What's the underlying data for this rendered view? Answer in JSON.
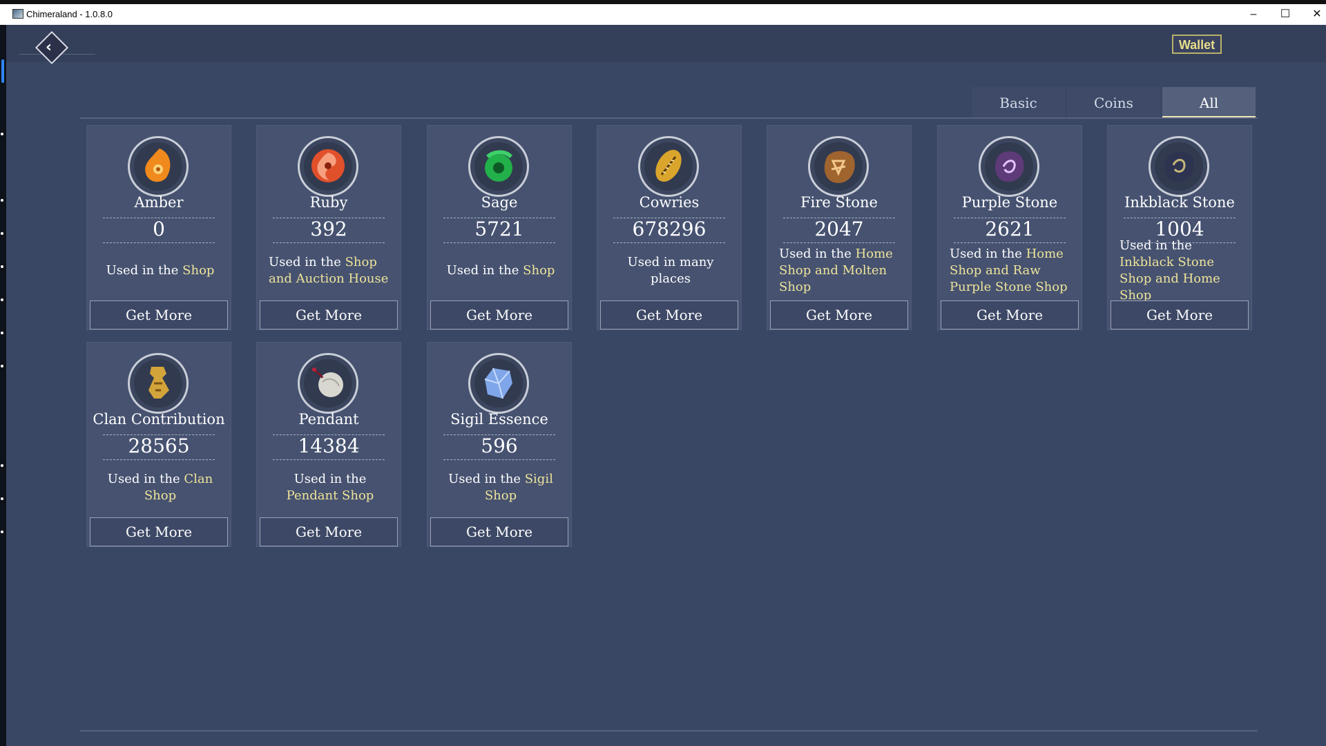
{
  "window": {
    "title": "Chimeraland - 1.0.8.0",
    "minimize": "–",
    "maximize": "☐",
    "close": "✕"
  },
  "header": {
    "back_icon": "chevron-left-icon",
    "back_glyph": "‹",
    "wallet_label": "Wallet"
  },
  "tabs": [
    {
      "label": "Basic",
      "selected": false
    },
    {
      "label": "Coins",
      "selected": false
    },
    {
      "label": "All",
      "selected": true
    }
  ],
  "cards": [
    {
      "name": "Amber",
      "count": "0",
      "desc_prefix": "Used in the ",
      "desc_hl": "Shop",
      "button": "Get More",
      "icon": "amber-icon",
      "color": "#f08a1c"
    },
    {
      "name": "Ruby",
      "count": "392",
      "desc_prefix": "Used in the ",
      "desc_hl": "Shop and Auction House",
      "button": "Get More",
      "icon": "ruby-icon",
      "color": "#e0502a"
    },
    {
      "name": "Sage",
      "count": "5721",
      "desc_prefix": "Used in the ",
      "desc_hl": "Shop",
      "button": "Get More",
      "icon": "sage-icon",
      "color": "#22b04a"
    },
    {
      "name": "Cowries",
      "count": "678296",
      "desc_prefix": "Used in many places",
      "desc_hl": "",
      "button": "Get More",
      "icon": "cowrie-shell-icon",
      "color": "#d9a52c"
    },
    {
      "name": "Fire Stone",
      "count": "2047",
      "desc_prefix": "Used in the ",
      "desc_hl": "Home Shop and Molten Shop",
      "button": "Get More",
      "icon": "fire-stone-icon",
      "color": "#a0642e"
    },
    {
      "name": "Purple Stone",
      "count": "2621",
      "desc_prefix": "Used in the ",
      "desc_hl": "Home Shop and Raw Purple Stone Shop",
      "button": "Get More",
      "icon": "purple-stone-icon",
      "color": "#5e3a78"
    },
    {
      "name": "Inkblack Stone",
      "count": "1004",
      "desc_prefix": "Used in the ",
      "desc_hl": "Inkblack Stone Shop and Home Shop",
      "button": "Get More",
      "icon": "inkblack-stone-icon",
      "color": "#2e3350"
    },
    {
      "name": "Clan Contribution",
      "count": "28565",
      "desc_prefix": "Used in the ",
      "desc_hl": "Clan Shop",
      "button": "Get More",
      "icon": "clan-token-icon",
      "color": "#d3a43a"
    },
    {
      "name": "Pendant",
      "count": "14384",
      "desc_prefix": "Used in the ",
      "desc_hl": "Pendant Shop",
      "button": "Get More",
      "icon": "pendant-icon",
      "color": "#d8d8d0"
    },
    {
      "name": "Sigil Essence",
      "count": "596",
      "desc_prefix": "Used in the ",
      "desc_hl": "Sigil Shop",
      "button": "Get More",
      "icon": "sigil-crystal-icon",
      "color": "#7fa6e8"
    }
  ]
}
